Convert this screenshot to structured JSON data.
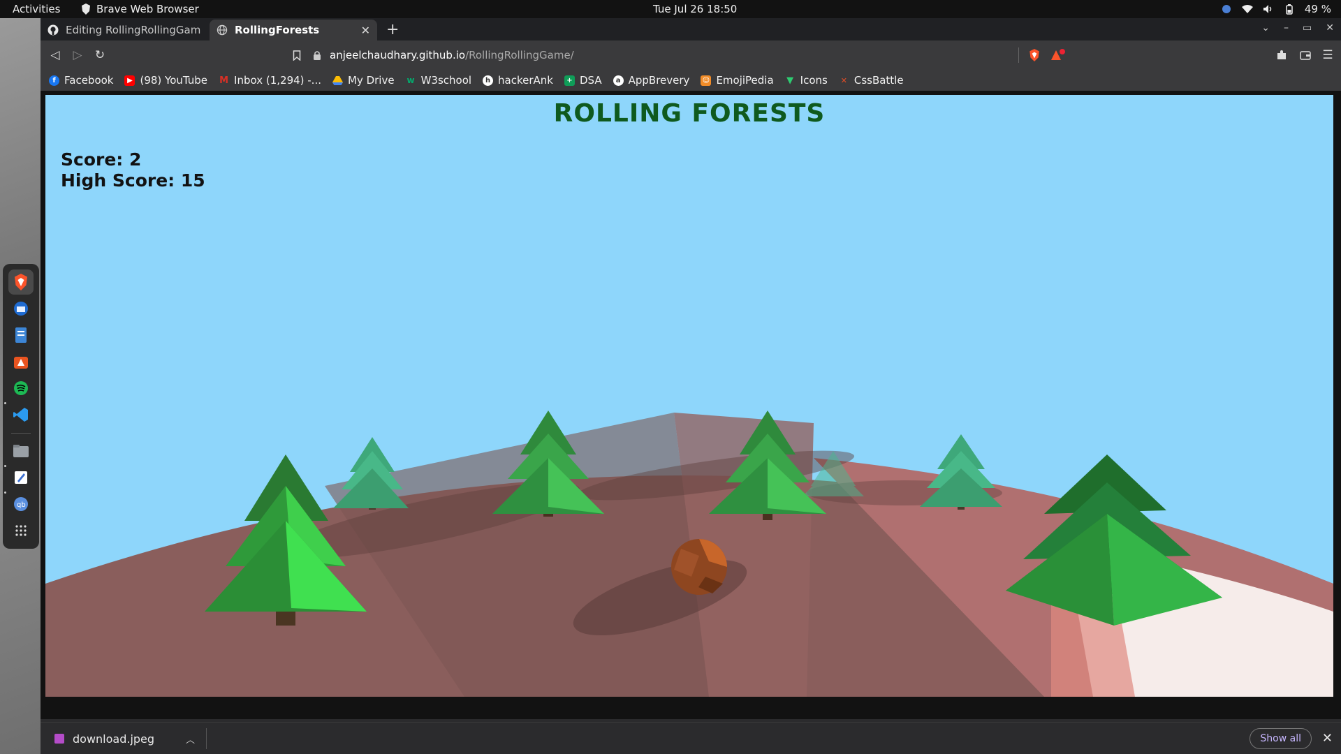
{
  "topbar": {
    "activities": "Activities",
    "app_name": "Brave Web Browser",
    "datetime": "Tue Jul 26  18:50",
    "battery": "49 %"
  },
  "tabs": [
    {
      "title": "Editing RollingRollingGame/R",
      "icon": "github-icon"
    },
    {
      "title": "RollingForests",
      "icon": "globe-icon"
    }
  ],
  "address": {
    "host": "anjeelchaudhary.github.io",
    "path": "/RollingRollingGame/"
  },
  "bookmarks": [
    {
      "label": "Facebook",
      "icon": "facebook-icon",
      "color": "#1877f2"
    },
    {
      "label": "(98) YouTube",
      "icon": "youtube-icon",
      "color": "#ff0000"
    },
    {
      "label": "Inbox (1,294) -...",
      "icon": "gmail-icon",
      "color": "#d93025"
    },
    {
      "label": "My Drive",
      "icon": "drive-icon",
      "color": "#fbbc04"
    },
    {
      "label": "W3school",
      "icon": "w3school-icon",
      "color": "#04aa6d"
    },
    {
      "label": "hackerAnk",
      "icon": "hackerrank-icon",
      "color": "#ffffff"
    },
    {
      "label": "DSA",
      "icon": "sheets-icon",
      "color": "#0f9d58"
    },
    {
      "label": "AppBrevery",
      "icon": "appbrewery-icon",
      "color": "#ffffff"
    },
    {
      "label": "EmojiPedia",
      "icon": "emojipedia-icon",
      "color": "#f28c28"
    },
    {
      "label": "Icons",
      "icon": "icons-icon",
      "color": "#2ecc71"
    },
    {
      "label": "CssBattle",
      "icon": "cssbattle-icon",
      "color": "#e44d26"
    }
  ],
  "game": {
    "title": "ROLLING FORESTS",
    "score_label": "Score: 2",
    "high_score_label": "High Score: 15",
    "sky_color": "#8ed6fb",
    "ground_color": "#8c6060"
  },
  "downloads": {
    "file": "download.jpeg",
    "show_all": "Show all"
  }
}
